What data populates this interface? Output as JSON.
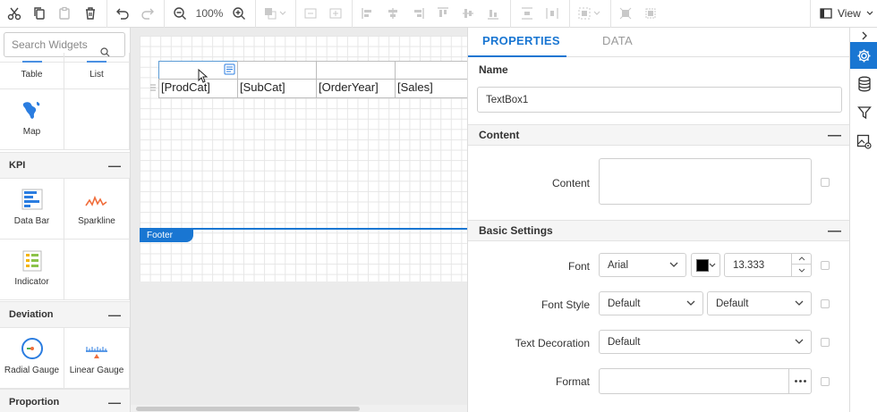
{
  "toolbar": {
    "zoom": "100%",
    "view_label": "View"
  },
  "widgets": {
    "search_placeholder": "Search Widgets",
    "top_items": [
      "Table",
      "List"
    ],
    "map_label": "Map",
    "categories": [
      {
        "name": "KPI",
        "items": [
          "Data Bar",
          "Sparkline",
          "Indicator"
        ]
      },
      {
        "name": "Deviation",
        "items": [
          "Radial Gauge",
          "Linear Gauge"
        ]
      },
      {
        "name": "Proportion"
      }
    ]
  },
  "design": {
    "cells": [
      "[ProdCat]",
      "[SubCat]",
      "[OrderYear]",
      "[Sales]"
    ],
    "footer_label": "Footer"
  },
  "properties": {
    "tabs": [
      "PROPERTIES",
      "DATA"
    ],
    "name_label": "Name",
    "name_value": "TextBox1",
    "content_section": "Content",
    "content_label": "Content",
    "basic_section": "Basic Settings",
    "font_label": "Font",
    "font_value": "Arial",
    "font_color": "#000000",
    "font_size": "13.333",
    "font_style_label": "Font Style",
    "font_style_value": "Default",
    "font_weight_value": "Default",
    "text_decoration_label": "Text Decoration",
    "text_decoration_value": "Default",
    "format_label": "Format",
    "format_value": ""
  },
  "colors": {
    "accent": "#1976d2"
  }
}
